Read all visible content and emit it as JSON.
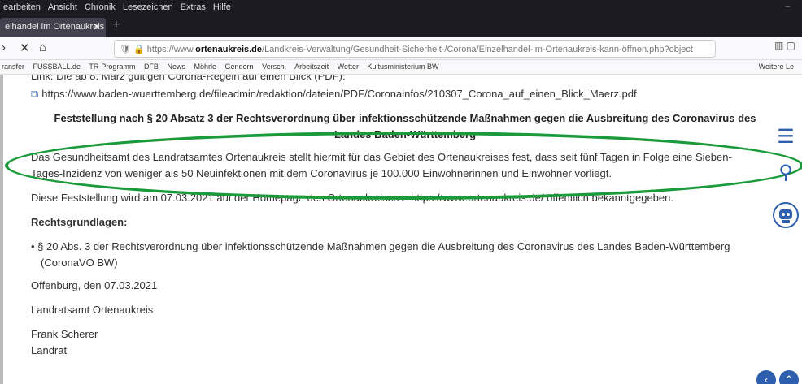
{
  "menu": [
    "earbeiten",
    "Ansicht",
    "Chronik",
    "Lesezeichen",
    "Extras",
    "Hilfe"
  ],
  "tab": {
    "title": "elhandel im Ortenaukreis k",
    "close": "✕",
    "new": "+"
  },
  "url": {
    "prefix": "https://www.",
    "domain": "ortenaukreis.de",
    "path": "/Landkreis-Verwaltung/Gesundheit-Sicherheit-/Corona/Einzelhandel-im-Ortenaukreis-kann-öffnen.php?object"
  },
  "bookmarks": [
    "ransfer",
    "FUSSBALL.de",
    "TR-Programm",
    "DFB",
    "News",
    "Möhrle",
    "Gendern",
    "Versch.",
    "Arbeitszeit",
    "Wetter",
    "Kultusministerium BW"
  ],
  "bookmarks_right": "Weitere Le",
  "content": {
    "link_partial": "Link: Die ab 8. März gültigen Corona-Regeln auf einen Blick (PDF):",
    "pdf_link": "https://www.baden-wuerttemberg.de/fileadmin/redaktion/dateien/PDF/Coronainfos/210307_Corona_auf_einen_Blick_Maerz.pdf",
    "heading_1": "Feststellung nach § 20 Absatz 3 der Rechtsverordnung über infektionsschützende Maßnahmen gegen die Ausbreitung des Coronavirus des",
    "heading_2": "Landes Baden-Württemberg",
    "para1_line1": "Das Gesundheitsamt des Landratsamtes Ortenaukreis stellt hiermit für das Gebiet des Ortenaukreises fest, dass seit fünf Tagen in Folge eine Sieben-",
    "para1_line2": "Tages-Inzidenz von weniger als 50 Neuinfektionen mit dem Coronavirus je 100.000 Einwohnerinnen und Einwohner vorliegt.",
    "para2": "Diese Feststellung wird am 07.03.2021 auf der Homepage des Ortenaukreises > https://www.ortenaukreis.de/ öffentlich bekanntgegeben.",
    "rechts_heading": "Rechtsgrundlagen:",
    "bullet_line1": "• § 20 Abs. 3 der Rechtsverordnung über infektionsschützende Maßnahmen gegen die Ausbreitung des Coronavirus des Landes Baden-Württemberg",
    "bullet_line2": "(CoronaVO BW)",
    "place_date": "Offenburg, den 07.03.2021",
    "office": "Landratsamt Ortenaukreis",
    "name": "Frank Scherer",
    "title": "Landrat"
  },
  "colors": {
    "annotation": "#1a9a3a",
    "accent": "#2d5fae"
  }
}
